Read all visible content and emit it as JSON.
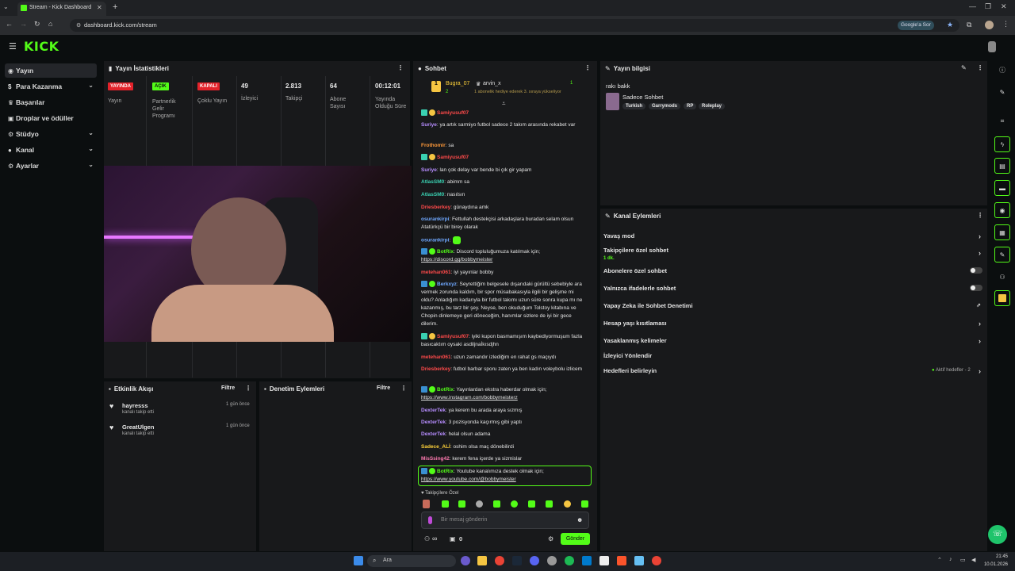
{
  "browser": {
    "tab_title": "Stream - Kick Dashboard",
    "url": "dashboard.kick.com/stream",
    "google_btn": "Google'a Sor"
  },
  "brand": {
    "logo": "KICK",
    "accent": "#53fc18"
  },
  "sidebar": {
    "items": [
      {
        "label": "Yayın",
        "icon": "broadcast-icon"
      },
      {
        "label": "Para Kazanma",
        "icon": "dollar-icon"
      },
      {
        "label": "Başarılar",
        "icon": "trophy-icon"
      },
      {
        "label": "Droplar ve ödüller",
        "icon": "gift-icon"
      },
      {
        "label": "Stüdyo",
        "icon": "gear-icon"
      },
      {
        "label": "Kanal",
        "icon": "user-icon"
      },
      {
        "label": "Ayarlar",
        "icon": "gear-icon"
      }
    ]
  },
  "stats": {
    "title": "Yayın İstatistikleri",
    "items": [
      {
        "badge": "YAYINDA",
        "label": "Yayın"
      },
      {
        "badge": "AÇIK",
        "label": "Partnerlik Gelir Programı"
      },
      {
        "badge": "KAPALI",
        "label": "Çoklu Yayın"
      },
      {
        "value": "49",
        "label": "İzleyici"
      },
      {
        "value": "2.813",
        "label": "Takipçi"
      },
      {
        "value": "64",
        "label": "Abone Sayısı"
      },
      {
        "value": "00:12:01",
        "label": "Yayında Olduğu Süre"
      }
    ]
  },
  "activity": {
    "title": "Etkinlik Akışı",
    "filter": "Filtre",
    "events": [
      {
        "user": "hayresss",
        "action": "kanalı takip etti",
        "time": "1 gün önce"
      },
      {
        "user": "GreatUlgen",
        "action": "kanalı takip etti",
        "time": "1 gün önce"
      }
    ]
  },
  "moderation": {
    "title": "Denetim Eylemleri",
    "filter": "Filtre"
  },
  "chat": {
    "title": "Sohbet",
    "pinned": {
      "user1": "Bugra_07",
      "user2": "arvin_x",
      "count1": "2",
      "count2": "1",
      "text": "1 abonelik hediye ederek 3. sıraya yükseliyor"
    },
    "messages": [
      {
        "user": "Samiyusuf07",
        "color": "#ff4a4a",
        "text": ""
      },
      {
        "user": "Suriye",
        "color": "#b78dff",
        "text": ": ya artık sarmiyo futbol sadece 2 takım arasında rekabet var"
      },
      {
        "user": "Frothomir",
        "color": "#ff9a3a",
        "text": ": sa"
      },
      {
        "user": "Samiyusuf07",
        "color": "#ff4a4a",
        "text": ""
      },
      {
        "user": "Suriye",
        "color": "#b78dff",
        "text": ": lan çok delay var bende bi çık gir yapam"
      },
      {
        "user": "AtlasSM0",
        "color": "#3ad1b2",
        "text": ": abimm sa"
      },
      {
        "user": "AtlasSM0",
        "color": "#3ad1b2",
        "text": ": nasılsın"
      },
      {
        "user": "Driesberkey",
        "color": "#ff4a4a",
        "text": ": günaydına amk"
      },
      {
        "user": "osurankirpi",
        "color": "#6fa8ff",
        "text": ": Fettullah destekçisi arkadaşlara buradan selam olsun Atatürkçü bir birey olarak"
      },
      {
        "user": "osurankirpi",
        "color": "#6fa8ff",
        "text": ":"
      },
      {
        "user": "BotRix",
        "color": "#53fc18",
        "text": ": Discord topluluğumuza katılmak için;",
        "link": "https://discord.gg/bobbymeister"
      },
      {
        "user": "metehan061",
        "color": "#ff4a4a",
        "text": ": iyi yayınlar bobby"
      },
      {
        "user": "Berkxyz",
        "color": "#6fa8ff",
        "text": ": Seyrettiğim belgesele dışarıdaki gürültü sebebiyle ara vermek zorunda kaldım, bir spor müsabakasıyla ilgili bir gelişme mi oldu? Anladığım kadarıyla bir futbol takımı uzun süre sonra kupa mı ne kazanmış, bu tarz bir şey. Neyse, ben okuduğum Tolstoy kitabına ve Chopin dinlemeye geri döneceğim, hanımlar sizlere de iyi bir gece dilerim."
      },
      {
        "user": "Samiyusuf07",
        "color": "#ff4a4a",
        "text": ": iyiki kupon basmamışım kaybediyormuşum fazla basıcaktım oysaki asdiljnaİkısdjhn"
      },
      {
        "user": "metehan061",
        "color": "#ff4a4a",
        "text": ": uzun zamandır izlediğim en rahat gs maçıydı"
      },
      {
        "user": "Driesberkey",
        "color": "#ff4a4a",
        "text": ": futbol barbar sporu zaten ya ben kadın voleybolu izlicem"
      },
      {
        "user": "BotRix",
        "color": "#53fc18",
        "text": ": Yayınlardan ekstra haberdar olmak için;",
        "link": "https://www.instagram.com/bobbymeisterz"
      },
      {
        "user": "DexterTek",
        "color": "#b78dff",
        "text": ": ya kerem bu arada araya sızmış"
      },
      {
        "user": "DexterTek",
        "color": "#b78dff",
        "text": ": 3 pozisyonda kaçırmış gibi yaptı"
      },
      {
        "user": "DexterTek",
        "color": "#b78dff",
        "text": ": helal olsun adama"
      },
      {
        "user": "Sadece_ALİ",
        "color": "#ffd23a",
        "text": ": oshim olsa maç dönebilirdi"
      },
      {
        "user": "MisSsing42",
        "color": "#ff7ab0",
        "text": ": kerem fena içerde ya sizmislar"
      },
      {
        "user": "BotRix",
        "color": "#53fc18",
        "text": ": Youtube kanalımıza destek olmak için;",
        "link": "https://www.youtube.com/@bobbymeister"
      }
    ],
    "followers_only": "Takipçilere Özel",
    "input_placeholder": "Bir mesaj gönderin",
    "infinity": "∞",
    "count": "0",
    "send": "Gönder"
  },
  "stream_info": {
    "title": "Yayın bilgisi",
    "stream_title": "rakı bakk",
    "category": "Sadece Sohbet",
    "tags": [
      "Turkish",
      "Garrymods",
      "RP",
      "Roleplay"
    ]
  },
  "channel_actions": {
    "title": "Kanal Eylemleri",
    "items": [
      {
        "label": "Yavaş mod",
        "control": "chevron"
      },
      {
        "label": "Takipçilere özel sohbet",
        "sub": "1 dk.",
        "control": "chevron"
      },
      {
        "label": "Abonelere özel sohbet",
        "control": "toggle"
      },
      {
        "label": "Yalnızca ifadelerle sohbet",
        "control": "toggle"
      },
      {
        "label": "Yapay Zeka ile Sohbet Denetimi",
        "control": "external"
      },
      {
        "label": "Hesap yaşı kısıtlaması",
        "control": "chevron"
      },
      {
        "label": "Yasaklanmış kelimeler",
        "control": "chevron"
      },
      {
        "label": "İzleyici Yönlendir",
        "control": "none"
      },
      {
        "label": "Hedefleri belirleyin",
        "control": "chevron",
        "extra": "Aktif hedefler - 2"
      }
    ]
  },
  "taskbar": {
    "search": "Ara",
    "time": "21:45",
    "date": "10.01.2026"
  }
}
